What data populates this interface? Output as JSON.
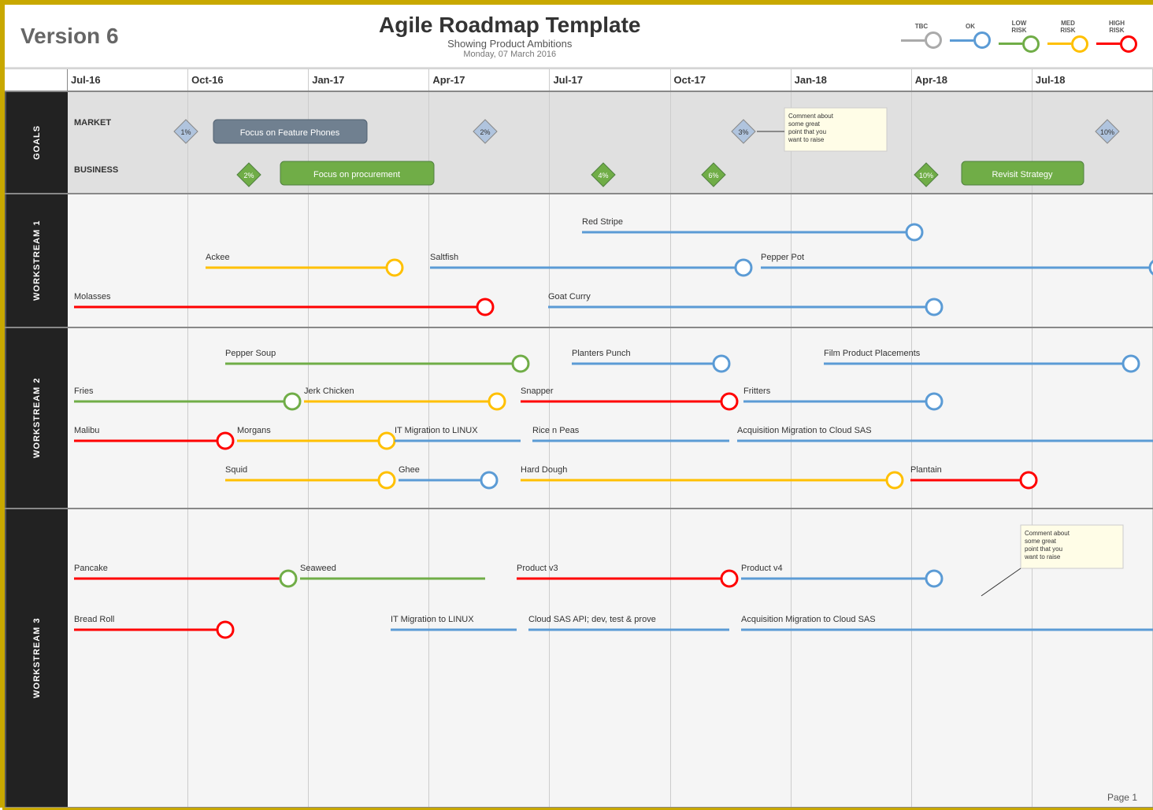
{
  "header": {
    "version": "Version 6",
    "title": "Agile Roadmap Template",
    "subtitle": "Showing Product Ambitions",
    "date": "Monday, 07 March 2016"
  },
  "legend": {
    "items": [
      {
        "label": "TBC",
        "type": "tbc"
      },
      {
        "label": "OK",
        "type": "ok"
      },
      {
        "label": "LOW\nRISK",
        "type": "low"
      },
      {
        "label": "MED\nRISK",
        "type": "med"
      },
      {
        "label": "HIGH\nRISK",
        "type": "high"
      }
    ]
  },
  "timeline": {
    "columns": [
      "Jul-16",
      "Oct-16",
      "Jan-17",
      "Apr-17",
      "Jul-17",
      "Oct-17",
      "Jan-18",
      "Apr-18",
      "Jul-18"
    ]
  },
  "sections": {
    "goals": "GOALS",
    "ws1": "WORKSTREAM 1",
    "ws2": "WORKSTREAM 2",
    "ws3": "WORKSTREAM 3"
  },
  "page": "Page 1"
}
